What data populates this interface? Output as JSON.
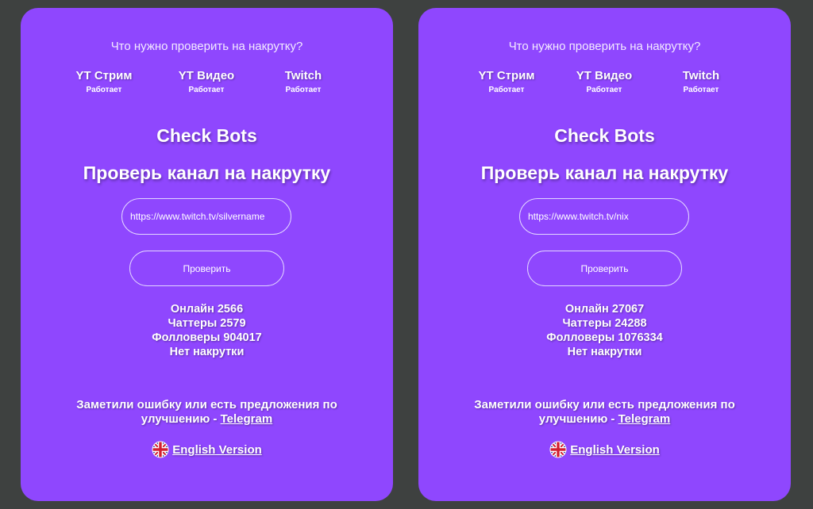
{
  "cards": [
    {
      "question": "Что нужно проверить на накрутку?",
      "services": [
        {
          "name": "YT Стрим",
          "status": "Работает"
        },
        {
          "name": "YT Видео",
          "status": "Работает"
        },
        {
          "name": "Twitch",
          "status": "Работает"
        }
      ],
      "brand": "Check Bots",
      "headline": "Проверь канал на накрутку",
      "input_value": "https://www.twitch.tv/silvername",
      "button_label": "Проверить",
      "stats": {
        "online": "Онлайн 2566",
        "chatters": "Чаттеры 2579",
        "followers": "Фолловеры 904017",
        "verdict": "Нет накрутки"
      },
      "feedback_text": "Заметили ошибку или есть предложения по улучшению - ",
      "feedback_link": "Telegram",
      "english_link": "English Version",
      "flag_icon": "uk-flag-icon"
    },
    {
      "question": "Что нужно проверить на накрутку?",
      "services": [
        {
          "name": "YT Стрим",
          "status": "Работает"
        },
        {
          "name": "YT Видео",
          "status": "Работает"
        },
        {
          "name": "Twitch",
          "status": "Работает"
        }
      ],
      "brand": "Check Bots",
      "headline": "Проверь канал на накрутку",
      "input_value": "https://www.twitch.tv/nix",
      "button_label": "Проверить",
      "stats": {
        "online": "Онлайн 27067",
        "chatters": "Чаттеры 24288",
        "followers": "Фолловеры 1076334",
        "verdict": "Нет накрутки"
      },
      "feedback_text": "Заметили ошибку или есть предложения по улучшению - ",
      "feedback_link": "Telegram",
      "english_link": "English Version",
      "flag_icon": "uk-flag-icon"
    }
  ],
  "colors": {
    "background": "#3e4140",
    "card": "#8f47fe",
    "border": "#e3d6ff",
    "text": "#ffffff"
  }
}
